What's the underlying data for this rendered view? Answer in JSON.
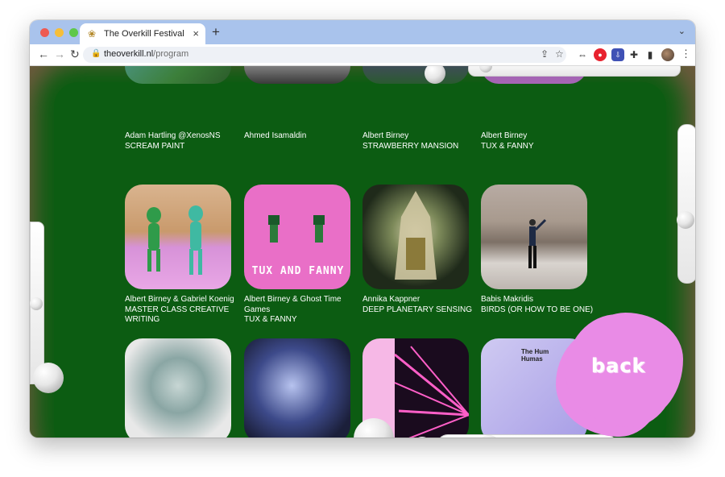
{
  "browser": {
    "tab_title": "The Overkill Festival",
    "url_domain": "theoverkill.nl",
    "url_path": "/program",
    "favicon_icon": "festival-favicon",
    "tab_close": "×",
    "new_tab": "+"
  },
  "program": {
    "rows": [
      [
        {
          "artist": "Adam Hartling @XenosNS",
          "title": "SCREAM PAINT"
        },
        {
          "artist": "Ahmed Isamaldin",
          "title": ""
        },
        {
          "artist": "Albert Birney",
          "title": "STRAWBERRY MANSION"
        },
        {
          "artist": "Albert Birney",
          "title": "TUX & FANNY"
        }
      ],
      [
        {
          "artist": "Albert Birney & Gabriel Koenig",
          "title": "MASTER CLASS CREATIVE WRITING"
        },
        {
          "artist": "Albert Birney & Ghost Time Games",
          "title": "TUX & FANNY"
        },
        {
          "artist": "Annika Kappner",
          "title": "DEEP PLANETARY SENSING"
        },
        {
          "artist": "Babis Makridis",
          "title": "BIRDS (OR HOW TO BE ONE)"
        }
      ]
    ],
    "thumb_texts": {
      "tux_and_fanny": "TUX AND FANNY",
      "the_hum": "The Hum Humas"
    }
  },
  "back_button": {
    "label": "back"
  },
  "colors": {
    "page_green": "#0c5c12",
    "blob_pink": "#e98be6",
    "frame_brown": "#6d5a3d"
  }
}
